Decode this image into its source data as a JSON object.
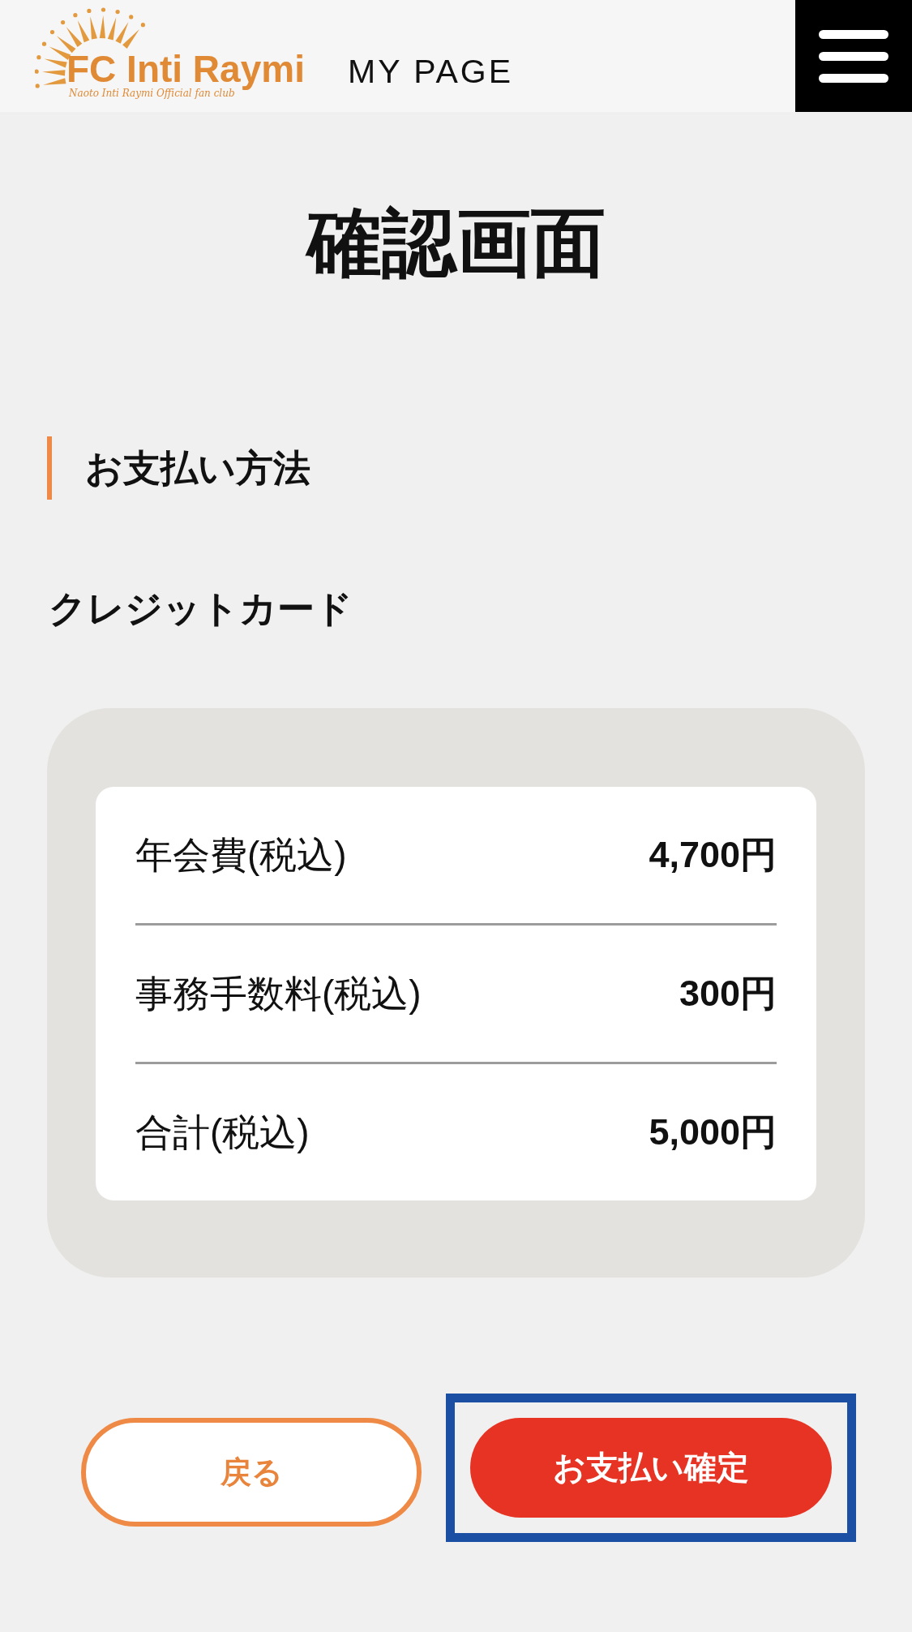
{
  "header": {
    "logo": {
      "title": "FC Inti Raymi",
      "subtitle": "Naoto Inti Raymi Official fan club"
    },
    "section": "MY PAGE"
  },
  "page_title": "確認画面",
  "payment_method": {
    "heading": "お支払い方法",
    "value": "クレジットカード"
  },
  "fees": [
    {
      "label": "年会費(税込)",
      "amount": "4,700円"
    },
    {
      "label": "事務手数料(税込)",
      "amount": "300円"
    },
    {
      "label": "合計(税込)",
      "amount": "5,000円"
    }
  ],
  "buttons": [
    {
      "kind": "back",
      "label": "戻る",
      "focused": false
    },
    {
      "kind": "confirm",
      "label": "お支払い確定",
      "focused": true
    }
  ]
}
